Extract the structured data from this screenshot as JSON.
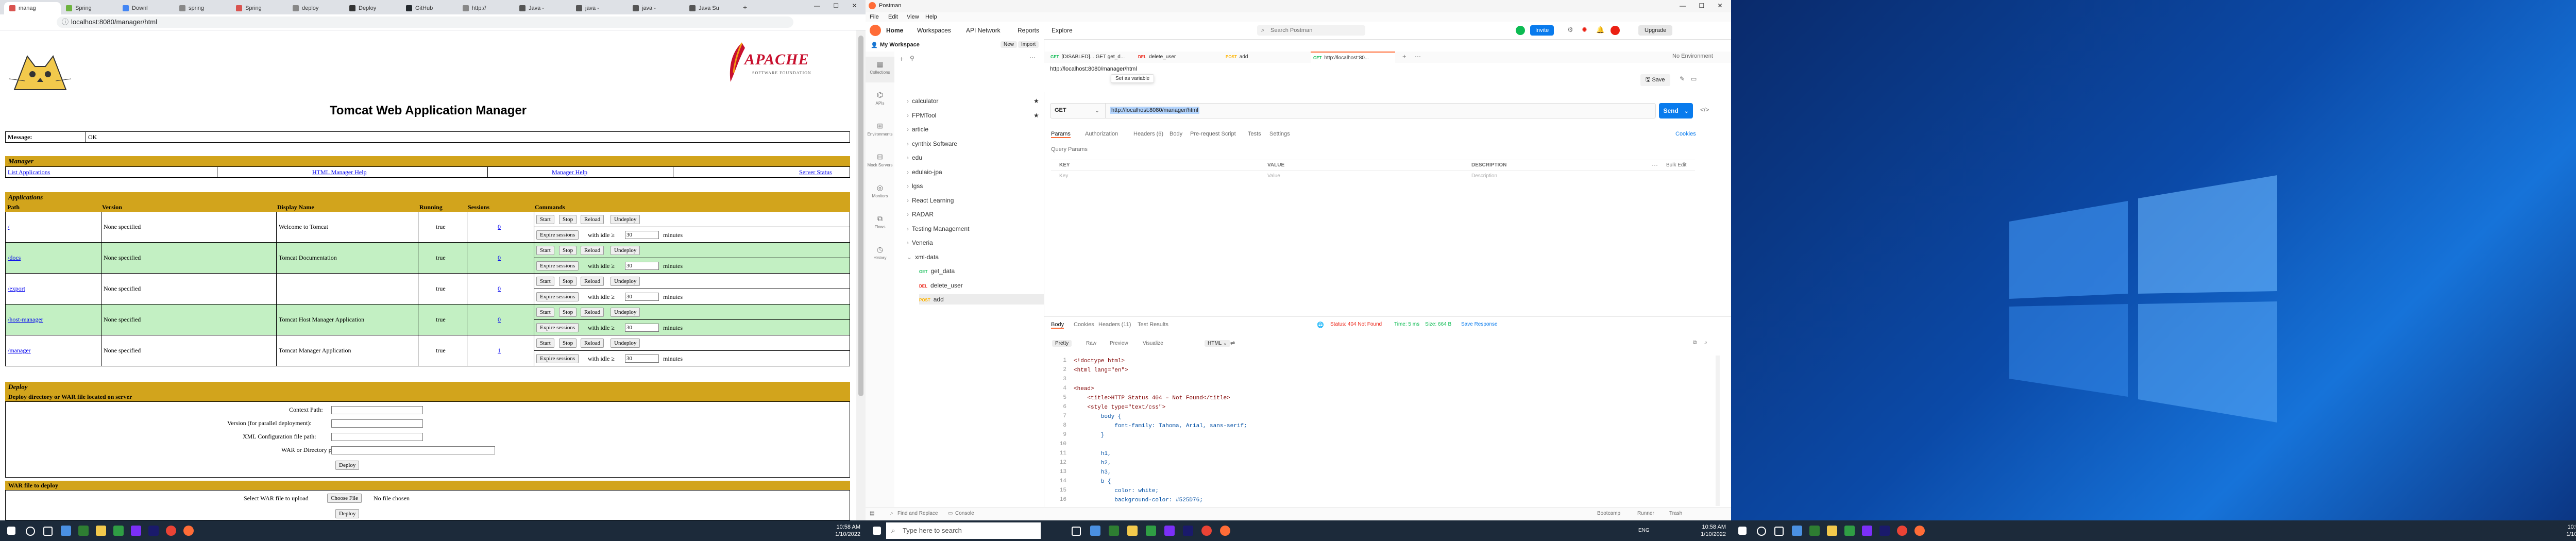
{
  "browser": {
    "tabs": [
      {
        "label": "manag",
        "color": "#d9534f"
      },
      {
        "label": "Spring",
        "color": "#6db33f"
      },
      {
        "label": "Downl",
        "color": "#4285f4"
      },
      {
        "label": "spring",
        "color": "#888888"
      },
      {
        "label": "Spring",
        "color": "#d9534f"
      },
      {
        "label": "deploy",
        "color": "#888888"
      },
      {
        "label": "Deploy",
        "color": "#333333"
      },
      {
        "label": "GitHub",
        "color": "#24292e"
      },
      {
        "label": "http://",
        "color": "#888888"
      },
      {
        "label": "Java -",
        "color": "#555555"
      },
      {
        "label": "java -",
        "color": "#555555"
      },
      {
        "label": "java -",
        "color": "#555555"
      },
      {
        "label": "Java Su",
        "color": "#555555"
      }
    ],
    "url": "localhost:8080/manager/html",
    "new_tab": "+"
  },
  "tomcat": {
    "title": "Tomcat Web Application Manager",
    "apache_logo": "APACHE",
    "apache_sub": "SOFTWARE FOUNDATION",
    "message_label": "Message:",
    "message_value": "OK",
    "manager_header": "Manager",
    "manager_links": [
      "List Applications",
      "HTML Manager Help",
      "Manager Help",
      "Server Status"
    ],
    "applications_header": "Applications",
    "columns": [
      "Path",
      "Version",
      "Display Name",
      "Running",
      "Sessions",
      "Commands"
    ],
    "apps": [
      {
        "path": "/",
        "version": "None specified",
        "display": "Welcome to Tomcat",
        "running": "true",
        "sessions": "0"
      },
      {
        "path": "/docs",
        "version": "None specified",
        "display": "Tomcat Documentation",
        "running": "true",
        "sessions": "0"
      },
      {
        "path": "/export",
        "version": "None specified",
        "display": "",
        "running": "true",
        "sessions": "0"
      },
      {
        "path": "/host-manager",
        "version": "None specified",
        "display": "Tomcat Host Manager Application",
        "running": "true",
        "sessions": "0"
      },
      {
        "path": "/manager",
        "version": "None specified",
        "display": "Tomcat Manager Application",
        "running": "true",
        "sessions": "1"
      }
    ],
    "cmd_start": "Start",
    "cmd_stop": "Stop",
    "cmd_reload": "Reload",
    "cmd_undeploy": "Undeploy",
    "cmd_expire": "Expire sessions",
    "cmd_idle": "with idle ≥",
    "cmd_idle_value": "30",
    "cmd_minutes": "minutes",
    "deploy_header": "Deploy",
    "deploy_sub": "Deploy directory or WAR file located on server",
    "context_path": "Context Path:",
    "version_label": "Version (for parallel deployment):",
    "xml_label": "XML Configuration file path:",
    "war_dir_label": "WAR or Directory path:",
    "deploy_button": "Deploy",
    "war_file_header": "WAR file to deploy",
    "select_war": "Select WAR file to upload",
    "choose_file": "Choose File",
    "no_file": "No file chosen",
    "deploy_button2": "Deploy"
  },
  "taskbar": {
    "time_left": "10:58 AM",
    "date_left": "1/10/2022",
    "time_mid": "10:58 AM",
    "date_mid": "1/10/2022",
    "time_right": "10:58 AM",
    "date_right": "1/10/2022",
    "search_placeholder": "Type here to search",
    "lang": "ENG"
  },
  "postman": {
    "window_title": "Postman",
    "menu": [
      "File",
      "Edit",
      "View",
      "Help"
    ],
    "nav": [
      "Home",
      "Workspaces",
      "API Network",
      "Reports",
      "Explore"
    ],
    "search": "Search Postman",
    "invite": "Invite",
    "upgrade": "Upgrade",
    "workspace": "My Workspace",
    "new": "New",
    "import": "Import",
    "rail": [
      "Collections",
      "APIs",
      "Environments",
      "Mock Servers",
      "Monitors",
      "Flows",
      "History"
    ],
    "tree": [
      "calculator",
      "FPMTool",
      "article",
      "cynthix Software",
      "edu",
      "edulaio-jpa",
      "lgss",
      "React Learning",
      "RADAR",
      "Testing Management",
      "Veneria",
      "xml-data"
    ],
    "tree_children": [
      {
        "method": "GET",
        "name": "get_data",
        "color": "#0cbb52"
      },
      {
        "method": "DEL",
        "name": "delete_user",
        "color": "#eb2013"
      },
      {
        "method": "POST",
        "name": "add",
        "color": "#ffb400"
      }
    ],
    "tabs": [
      {
        "method": "GET",
        "name": "[DISABLED]... GET get_d...",
        "color": "#0cbb52"
      },
      {
        "method": "DEL",
        "name": "delete_user",
        "color": "#eb2013"
      },
      {
        "method": "POST",
        "name": "add",
        "color": "#ffb400"
      },
      {
        "method": "GET",
        "name": "http://localhost:80...",
        "color": "#0cbb52"
      }
    ],
    "env": "No Environment",
    "request_url_title": "http://localhost:8080/manager/html",
    "set_as_variable": "Set as variable",
    "save": "Save",
    "method": "GET",
    "request_url": "http://localhost:8080/manager/html",
    "send": "Send",
    "req_tabs": [
      "Params",
      "Authorization",
      "Headers (6)",
      "Body",
      "Pre-request Script",
      "Tests",
      "Settings"
    ],
    "cookies": "Cookies",
    "query_params": "Query Params",
    "table_cols": [
      "KEY",
      "VALUE",
      "DESCRIPTION"
    ],
    "bulk_edit": "Bulk Edit",
    "placeholder_key": "Key",
    "placeholder_value": "Value",
    "placeholder_desc": "Description",
    "resp_tabs": [
      "Body",
      "Cookies",
      "Headers (11)",
      "Test Results"
    ],
    "status": "Status: 404 Not Found",
    "time": "Time: 5 ms",
    "size": "Size: 664 B",
    "save_response": "Save Response",
    "view_modes": [
      "Pretty",
      "Raw",
      "Preview",
      "Visualize"
    ],
    "format": "HTML",
    "code": [
      "<!doctype html>",
      "<html lang=\"en\">",
      "",
      "<head>",
      "    <title>HTTP Status 404 – Not Found</title>",
      "    <style type=\"text/css\">",
      "        body {",
      "            font-family: Tahoma, Arial, sans-serif;",
      "        }",
      "",
      "        h1,",
      "        h2,",
      "        h3,",
      "        b {",
      "            color: white;",
      "            background-color: #525D76;"
    ],
    "footer": [
      "Find and Replace",
      "Console"
    ],
    "footer_right": [
      "Bootcamp",
      "Runner",
      "Trash"
    ]
  }
}
